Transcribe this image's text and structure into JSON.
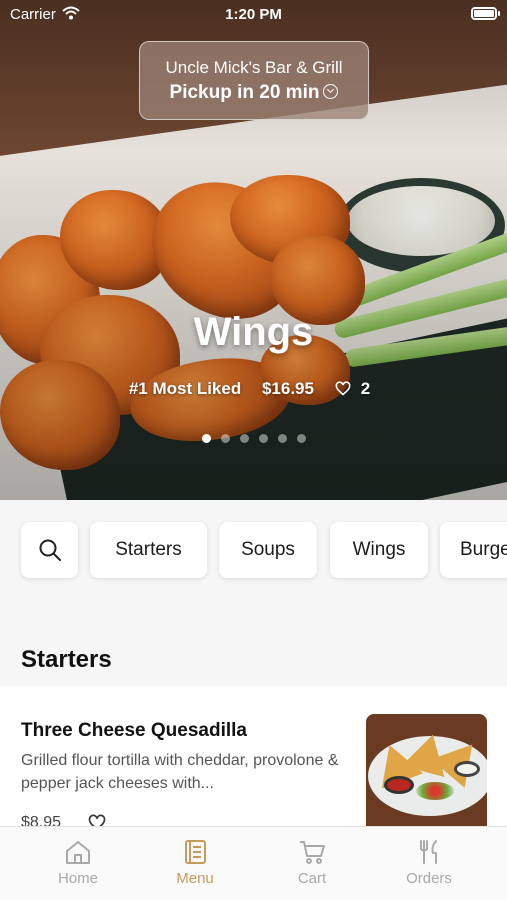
{
  "status_bar": {
    "carrier": "Carrier",
    "time": "1:20 PM"
  },
  "pickup": {
    "restaurant": "Uncle Mick's Bar & Grill",
    "pickup_text": "Pickup in 20 min"
  },
  "hero": {
    "title": "Wings",
    "badge": "#1 Most Liked",
    "price": "$16.95",
    "likes": "2",
    "page_count": 6,
    "active_page": 1
  },
  "categories": [
    {
      "label": "Starters"
    },
    {
      "label": "Soups"
    },
    {
      "label": "Wings"
    },
    {
      "label": "Burgers"
    }
  ],
  "section": {
    "title": "Starters"
  },
  "menu_items": [
    {
      "name": "Three Cheese Quesadilla",
      "description": "Grilled flour tortilla with cheddar, provolone & pepper jack cheeses with...",
      "price": "$8.95"
    }
  ],
  "tabbar": {
    "items": [
      {
        "label": "Home",
        "icon": "home-icon",
        "active": false
      },
      {
        "label": "Menu",
        "icon": "menu-book-icon",
        "active": true
      },
      {
        "label": "Cart",
        "icon": "cart-icon",
        "active": false
      },
      {
        "label": "Orders",
        "icon": "utensils-icon",
        "active": false
      }
    ]
  },
  "colors": {
    "accent": "#c69a5e",
    "inactive": "#a9a9a9"
  }
}
